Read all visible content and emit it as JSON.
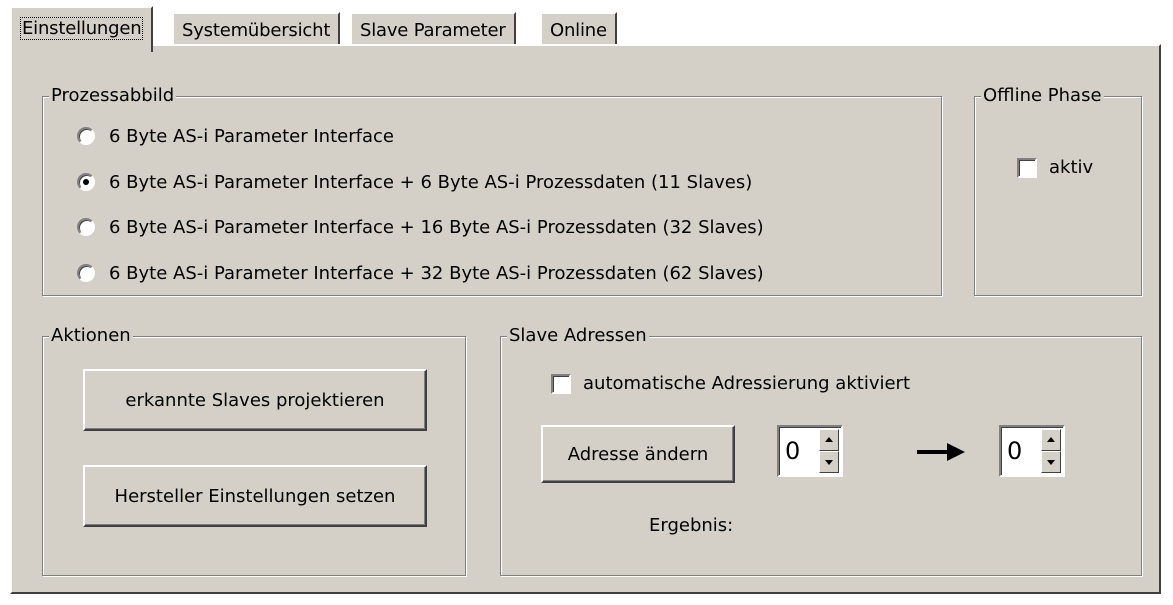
{
  "tabs": [
    {
      "label": "Einstellungen",
      "active": true
    },
    {
      "label": "Systemübersicht",
      "active": false
    },
    {
      "label": "Slave Parameter",
      "active": false
    },
    {
      "label": "Online",
      "active": false
    }
  ],
  "prozessabbild": {
    "title": "Prozessabbild",
    "options": [
      {
        "label": "6 Byte AS-i Parameter Interface",
        "checked": false
      },
      {
        "label": "6 Byte AS-i Parameter Interface + 6 Byte AS-i Prozessdaten (11 Slaves)",
        "checked": true
      },
      {
        "label": "6 Byte AS-i Parameter Interface + 16 Byte AS-i Prozessdaten (32 Slaves)",
        "checked": false
      },
      {
        "label": "6 Byte AS-i Parameter Interface + 32 Byte AS-i Prozessdaten (62 Slaves)",
        "checked": false
      }
    ]
  },
  "offline_phase": {
    "title": "Offline Phase",
    "checkbox_label": "aktiv",
    "checked": false
  },
  "aktionen": {
    "title": "Aktionen",
    "button1": "erkannte Slaves projektieren",
    "button2": "Hersteller Einstellungen setzen"
  },
  "slave_adressen": {
    "title": "Slave Adressen",
    "auto_label": "automatische Adressierung aktiviert",
    "auto_checked": false,
    "change_button": "Adresse ändern",
    "from_value": "0",
    "to_value": "0",
    "result_label": "Ergebnis:",
    "arrow_icon": "arrow-right-icon"
  },
  "colors": {
    "face": "#d4d0c8",
    "shadow": "#808080",
    "highlight": "#ffffff"
  }
}
